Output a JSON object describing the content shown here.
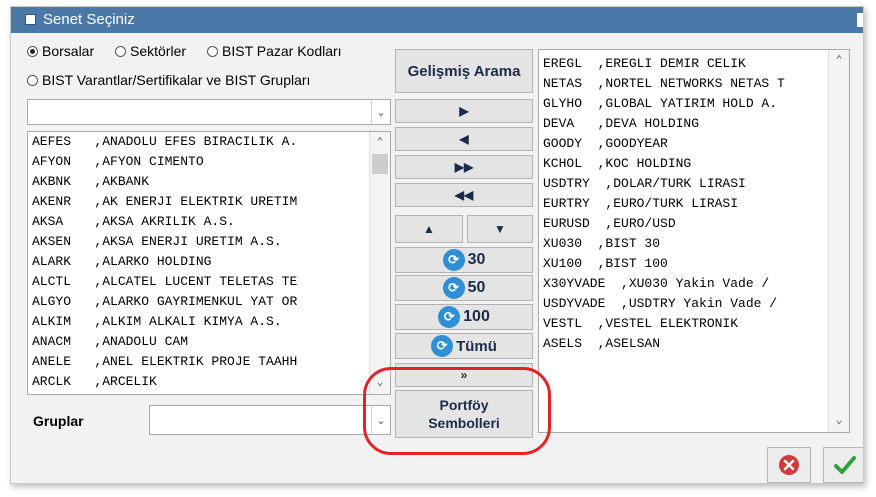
{
  "window": {
    "title": "Senet Seçiniz"
  },
  "radios": {
    "borsalar": {
      "label": "Borsalar",
      "selected": true
    },
    "sektorler": {
      "label": "Sektörler",
      "selected": false
    },
    "bist_pazar": {
      "label": "BIST Pazar Kodları",
      "selected": false
    },
    "bist_varant": {
      "label": "BIST Varantlar/Sertifikalar ve BIST Grupları",
      "selected": false
    }
  },
  "left_list": {
    "items": [
      "AEFES   ,ANADOLU EFES BIRACILIK A.",
      "AFYON   ,AFYON CIMENTO",
      "AKBNK   ,AKBANK",
      "AKENR   ,AK ENERJI ELEKTRIK URETIM",
      "AKSA    ,AKSA AKRILIK A.S.",
      "AKSEN   ,AKSA ENERJI URETIM A.S.",
      "ALARK   ,ALARKO HOLDING",
      "ALCTL   ,ALCATEL LUCENT TELETAS TE",
      "ALGYO   ,ALARKO GAYRIMENKUL YAT OR",
      "ALKIM   ,ALKIM ALKALI KIMYA A.S.",
      "ANACM   ,ANADOLU CAM",
      "ANELE   ,ANEL ELEKTRIK PROJE TAAHH",
      "ARCLK   ,ARCELIK"
    ]
  },
  "gruplar": {
    "label": "Gruplar",
    "value": ""
  },
  "buttons": {
    "gelismis_arama": "Gelişmiş Arama",
    "add_one": "▶",
    "remove_one": "◀",
    "add_all": "▶▶",
    "remove_all": "◀◀",
    "move_up": "▲",
    "move_down": "▼",
    "top30": "30",
    "top50": "50",
    "top100": "100",
    "tumu": "Tümü",
    "hidden_partial": "»",
    "portfoy_line1": "Portföy",
    "portfoy_line2": "Sembolleri"
  },
  "right_list": {
    "items": [
      "EREGL  ,EREGLI DEMIR CELIK",
      "NETAS  ,NORTEL NETWORKS NETAS T",
      "GLYHO  ,GLOBAL YATIRIM HOLD A.",
      "DEVA   ,DEVA HOLDING",
      "GOODY  ,GOODYEAR",
      "KCHOL  ,KOC HOLDING",
      "USDTRY  ,DOLAR/TURK LIRASI",
      "EURTRY  ,EURO/TURK LIRASI",
      "EURUSD  ,EURO/USD",
      "XU030  ,BIST 30",
      "XU100  ,BIST 100",
      "X30YVADE  ,XU030 Yakin Vade /",
      "USDYVADE  ,USDTRY Yakin Vade /",
      "VESTL  ,VESTEL ELEKTRONIK",
      "ASELS  ,ASELSAN"
    ]
  },
  "colors": {
    "titlebar": "#4a79a8",
    "highlight": "#e3222a",
    "ok_check": "#2ea043",
    "cancel": "#d23b3b"
  },
  "icons": {
    "window_icon": "window-icon",
    "cancel": "cancel-icon",
    "ok": "checkmark-icon",
    "index": "index-icon"
  }
}
